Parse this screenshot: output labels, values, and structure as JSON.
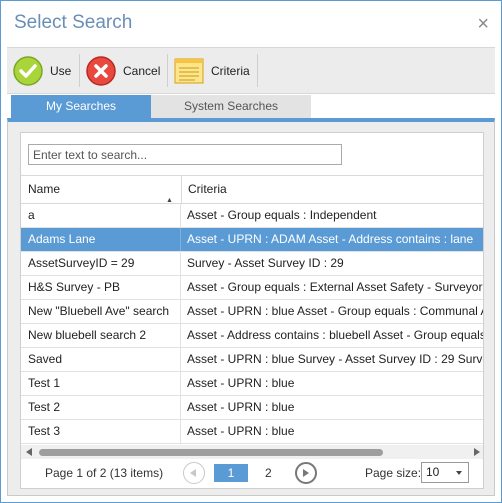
{
  "window": {
    "title": "Select Search",
    "close_glyph": "×"
  },
  "toolbar": {
    "use_label": "Use",
    "cancel_label": "Cancel",
    "criteria_label": "Criteria",
    "use_icon": "check-icon",
    "cancel_icon": "cancel-icon",
    "criteria_icon": "notepad-icon"
  },
  "tabs": [
    {
      "label": "My Searches",
      "active": true
    },
    {
      "label": "System Searches",
      "active": false
    }
  ],
  "search": {
    "placeholder": "Enter text to search...",
    "value": ""
  },
  "table": {
    "columns": [
      "Name",
      "Criteria"
    ],
    "sort_indicator": "▲",
    "rows": [
      {
        "name": "a",
        "criteria": "Asset - Group equals : Independent"
      },
      {
        "name": "Adams Lane",
        "criteria": "Asset - UPRN : ADAM Asset - Address contains : lane"
      },
      {
        "name": "AssetSurveyID = 29",
        "criteria": "Survey - Asset Survey ID : 29"
      },
      {
        "name": "H&S Survey - PB",
        "criteria": "Asset - Group equals : External Asset Safety - Surveyor e"
      },
      {
        "name": "New \"Bluebell Ave\" search",
        "criteria": "Asset - UPRN : blue Asset - Group equals : Communal A"
      },
      {
        "name": "New bluebell search 2",
        "criteria": "Asset - Address contains : bluebell Asset - Group equals"
      },
      {
        "name": "Saved",
        "criteria": "Asset - UPRN : blue Survey - Asset Survey ID : 29 Survey"
      },
      {
        "name": "Test 1",
        "criteria": "Asset - UPRN : blue"
      },
      {
        "name": "Test 2",
        "criteria": "Asset - UPRN : blue"
      },
      {
        "name": "Test 3",
        "criteria": "Asset - UPRN : blue"
      }
    ],
    "selected_row": "Adams Lane"
  },
  "pager": {
    "info": "Page 1 of 2 (13 items)",
    "current_page": "1",
    "next_page": "2",
    "page_size_label": "Page size:",
    "page_size": "10"
  },
  "colors": {
    "accent": "#5b9bd5",
    "title": "#6a8fb6",
    "toolbar_bg": "#ececec"
  }
}
